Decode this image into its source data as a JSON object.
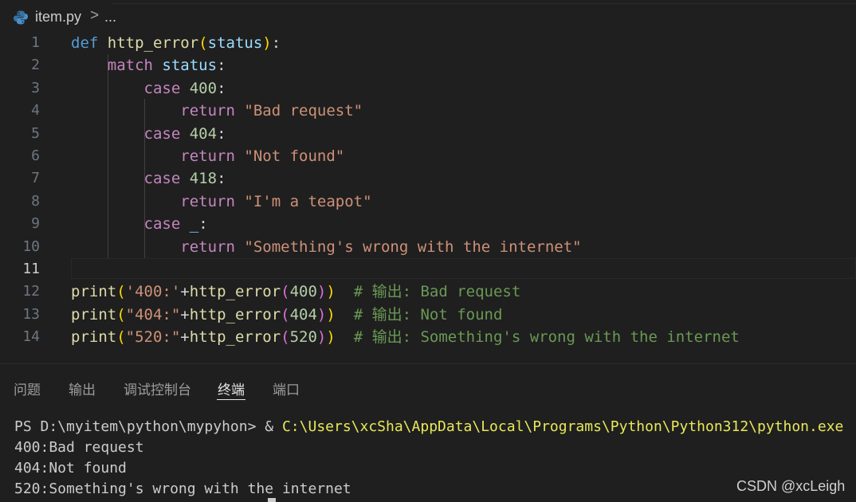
{
  "breadcrumb": {
    "file_name": "item.py",
    "separator": ">",
    "more": "...",
    "file_icon": "python-icon"
  },
  "editor": {
    "line_numbers": [
      "1",
      "2",
      "3",
      "4",
      "5",
      "6",
      "7",
      "8",
      "9",
      "10",
      "11",
      "12",
      "13",
      "14"
    ],
    "active_line": "11",
    "lines": [
      [
        [
          "kw",
          "def"
        ],
        [
          "pun",
          " "
        ],
        [
          "fn",
          "http_error"
        ],
        [
          "b1",
          "("
        ],
        [
          "var",
          "status"
        ],
        [
          "b1",
          ")"
        ],
        [
          "pun",
          ":"
        ]
      ],
      [
        [
          "pun",
          "    "
        ],
        [
          "ctl",
          "match"
        ],
        [
          "pun",
          " "
        ],
        [
          "var",
          "status"
        ],
        [
          "pun",
          ":"
        ]
      ],
      [
        [
          "pun",
          "        "
        ],
        [
          "ctl",
          "case"
        ],
        [
          "pun",
          " "
        ],
        [
          "num",
          "400"
        ],
        [
          "pun",
          ":"
        ]
      ],
      [
        [
          "pun",
          "            "
        ],
        [
          "ctl",
          "return"
        ],
        [
          "pun",
          " "
        ],
        [
          "str",
          "\"Bad request\""
        ]
      ],
      [
        [
          "pun",
          "        "
        ],
        [
          "ctl",
          "case"
        ],
        [
          "pun",
          " "
        ],
        [
          "num",
          "404"
        ],
        [
          "pun",
          ":"
        ]
      ],
      [
        [
          "pun",
          "            "
        ],
        [
          "ctl",
          "return"
        ],
        [
          "pun",
          " "
        ],
        [
          "str",
          "\"Not found\""
        ]
      ],
      [
        [
          "pun",
          "        "
        ],
        [
          "ctl",
          "case"
        ],
        [
          "pun",
          " "
        ],
        [
          "num",
          "418"
        ],
        [
          "pun",
          ":"
        ]
      ],
      [
        [
          "pun",
          "            "
        ],
        [
          "ctl",
          "return"
        ],
        [
          "pun",
          " "
        ],
        [
          "str",
          "\"I'm a teapot\""
        ]
      ],
      [
        [
          "pun",
          "        "
        ],
        [
          "ctl",
          "case"
        ],
        [
          "pun",
          " "
        ],
        [
          "var",
          "_"
        ],
        [
          "pun",
          ":"
        ]
      ],
      [
        [
          "pun",
          "            "
        ],
        [
          "ctl",
          "return"
        ],
        [
          "pun",
          " "
        ],
        [
          "str",
          "\"Something's wrong with the internet\""
        ]
      ],
      [],
      [
        [
          "fn",
          "print"
        ],
        [
          "b1",
          "("
        ],
        [
          "str",
          "'400:'"
        ],
        [
          "pun",
          "+"
        ],
        [
          "fn",
          "http_error"
        ],
        [
          "b2",
          "("
        ],
        [
          "num",
          "400"
        ],
        [
          "b2",
          ")"
        ],
        [
          "b1",
          ")"
        ],
        [
          "pun",
          "  "
        ],
        [
          "cmt",
          "# 输出: Bad request"
        ]
      ],
      [
        [
          "fn",
          "print"
        ],
        [
          "b1",
          "("
        ],
        [
          "str",
          "\"404:\""
        ],
        [
          "pun",
          "+"
        ],
        [
          "fn",
          "http_error"
        ],
        [
          "b2",
          "("
        ],
        [
          "num",
          "404"
        ],
        [
          "b2",
          ")"
        ],
        [
          "b1",
          ")"
        ],
        [
          "pun",
          "  "
        ],
        [
          "cmt",
          "# 输出: Not found"
        ]
      ],
      [
        [
          "fn",
          "print"
        ],
        [
          "b1",
          "("
        ],
        [
          "str",
          "\"520:\""
        ],
        [
          "pun",
          "+"
        ],
        [
          "fn",
          "http_error"
        ],
        [
          "b2",
          "("
        ],
        [
          "num",
          "520"
        ],
        [
          "b2",
          ")"
        ],
        [
          "b1",
          ")"
        ],
        [
          "pun",
          "  "
        ],
        [
          "cmt",
          "# 输出: Something's wrong with the internet"
        ]
      ]
    ]
  },
  "panel": {
    "tabs": [
      {
        "label": "问题"
      },
      {
        "label": "输出"
      },
      {
        "label": "调试控制台"
      },
      {
        "label": "终端"
      },
      {
        "label": "端口"
      }
    ],
    "active_tab": "终端"
  },
  "terminal": {
    "prompt": "PS D:\\myitem\\python\\mypyhon> ",
    "operator": "& ",
    "command_path": "C:\\Users\\xcSha\\AppData\\Local\\Programs\\Python\\Python312\\python.exe",
    "output": [
      "400:Bad request",
      "404:Not found",
      "520:Something's wrong with the internet"
    ]
  },
  "watermark": "CSDN @xcLeigh",
  "colors": {
    "background": "#1f1f1f",
    "keyword": "#569cd6",
    "control": "#c586c0",
    "function": "#dcdcaa",
    "variable": "#9cdcfe",
    "number": "#b5cea8",
    "string": "#ce9178",
    "comment": "#6a9955",
    "terminal_path": "#e8e85a"
  }
}
